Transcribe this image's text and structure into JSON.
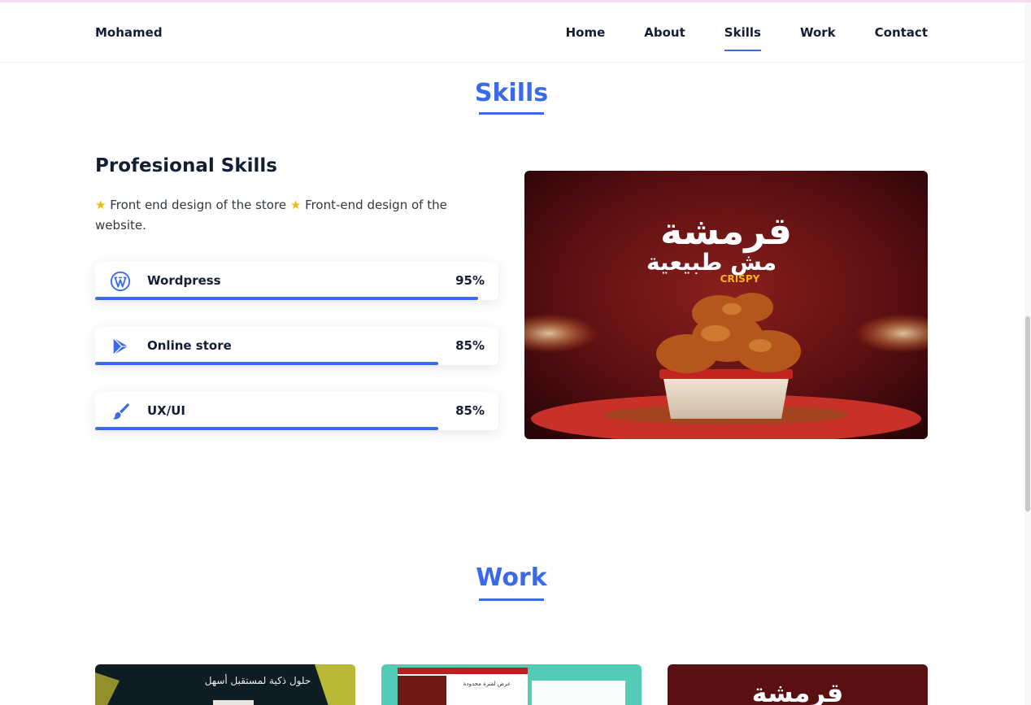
{
  "header": {
    "brand": "Mohamed",
    "nav": [
      "Home",
      "About",
      "Skills",
      "Work",
      "Contact"
    ],
    "active_nav": "Skills"
  },
  "skills": {
    "title": "Skills",
    "heading": "Profesional Skills",
    "description": {
      "part1": "Front end design of the store",
      "part2": "Front-end design of the website.",
      "star_glyph": "★"
    },
    "items": [
      {
        "name": "Wordpress",
        "percent_label": "95%",
        "percent": 95,
        "icon": "wordpress-icon"
      },
      {
        "name": "Online store",
        "percent_label": "85%",
        "percent": 85,
        "icon": "play-store-icon"
      },
      {
        "name": "UX/UI",
        "percent_label": "85%",
        "percent": 85,
        "icon": "paintbrush-icon"
      }
    ],
    "image": {
      "arabic_title_1": "قرمشة",
      "arabic_title_2": "مش طبيعية",
      "english_tag": "CRISPY"
    }
  },
  "work": {
    "title": "Work",
    "cards": [
      {
        "caption": "حلول ذكية لمستقبل أسهل"
      },
      {
        "caption": "عرض لفترة محدودة"
      },
      {
        "caption": "قرمشة"
      }
    ]
  },
  "colors": {
    "accent": "#3b6ae8",
    "text": "#141e33",
    "star": "#f2b80c",
    "food_bg": "#5a0f12"
  }
}
